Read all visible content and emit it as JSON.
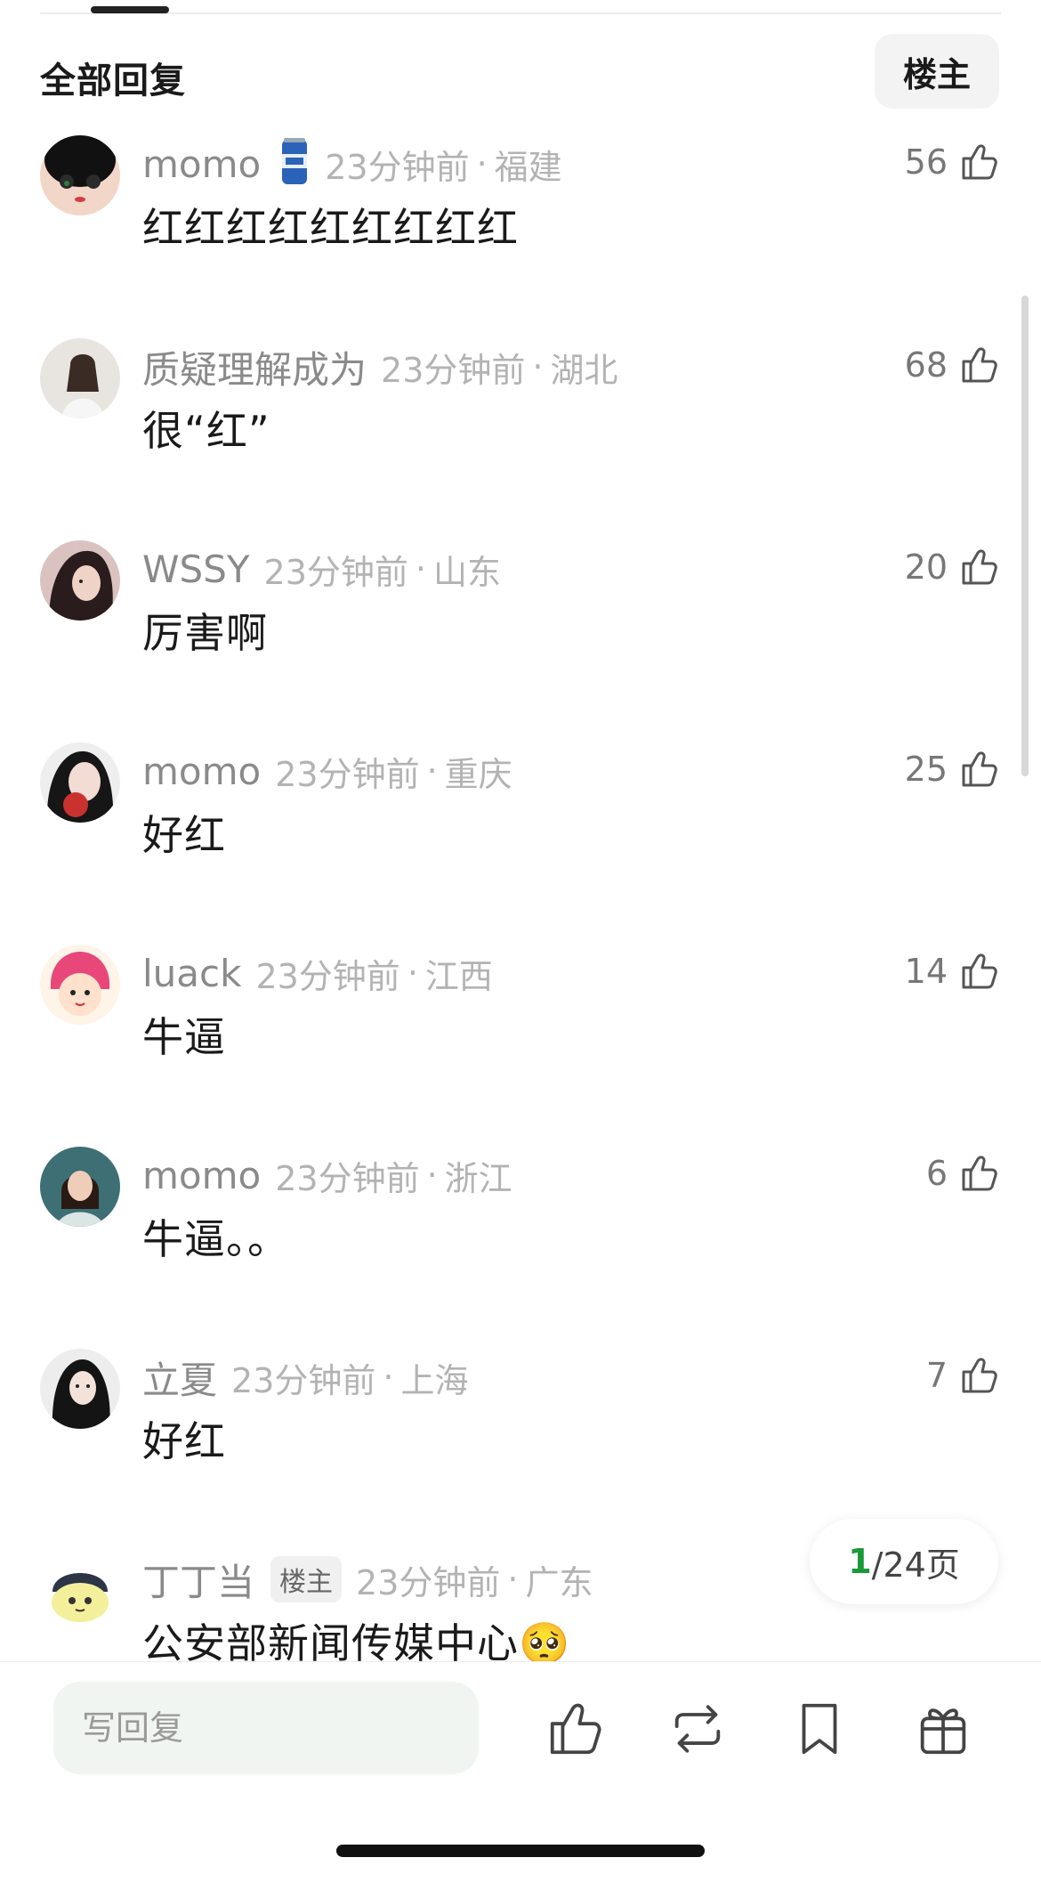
{
  "header": {
    "title": "全部回复",
    "op_filter": "楼主"
  },
  "comments": [
    {
      "user": "momo",
      "has_badge": true,
      "time": "23分钟前",
      "sep": "·",
      "region": "福建",
      "text": "红红红红红红红红红",
      "likes": "56"
    },
    {
      "user": "质疑理解成为",
      "time": "23分钟前",
      "sep": "·",
      "region": "湖北",
      "text": "很“红”",
      "likes": "68"
    },
    {
      "user": "WSSY",
      "time": "23分钟前",
      "sep": "·",
      "region": "山东",
      "text": "厉害啊",
      "likes": "20"
    },
    {
      "user": "momo",
      "time": "23分钟前",
      "sep": "·",
      "region": "重庆",
      "text": "好红",
      "likes": "25"
    },
    {
      "user": "luack",
      "time": "23分钟前",
      "sep": "·",
      "region": "江西",
      "text": "牛逼",
      "likes": "14"
    },
    {
      "user": "momo",
      "time": "23分钟前",
      "sep": "·",
      "region": "浙江",
      "text": "牛逼。。",
      "likes": "6"
    },
    {
      "user": "立夏",
      "time": "23分钟前",
      "sep": "·",
      "region": "上海",
      "text": "好红",
      "likes": "7"
    },
    {
      "user": "丁丁当",
      "op_tag": "楼主",
      "time": "23分钟前",
      "sep": "·",
      "region": "广东",
      "text": "公安部新闻传媒中心🥺",
      "likes": ""
    }
  ],
  "pagination": {
    "current": "1",
    "total_label": "/24页"
  },
  "bottom_bar": {
    "reply_placeholder": "写回复",
    "icons": [
      "thumbs-up-icon",
      "repost-icon",
      "bookmark-icon",
      "gift-icon"
    ]
  },
  "colors": {
    "accent_green": "#1a9a3a",
    "meta_gray": "#b3b3b3",
    "input_bg": "#f0f5f1"
  }
}
